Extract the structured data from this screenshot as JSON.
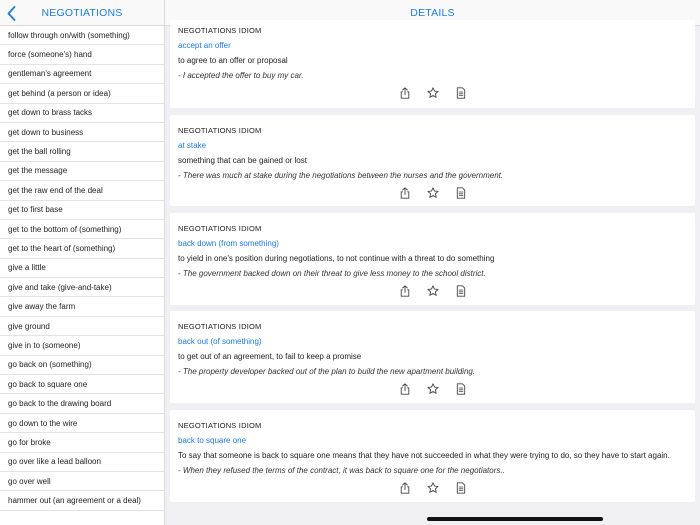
{
  "sidebar": {
    "title": "NEGOTIATIONS",
    "items": [
      "follow through on/with (something)",
      "force (someone's) hand",
      "gentleman's agreement",
      "get behind (a person or idea)",
      "get down to brass tacks",
      "get down to business",
      "get the ball rolling",
      "get the message",
      "get the raw end of the deal",
      "get to first base",
      "get to the bottom of (something)",
      "get to the heart of (something)",
      "give a little",
      "give and take (give-and-take)",
      "give away the farm",
      "give ground",
      "give in to (someone)",
      "go back on (something)",
      "go back to square one",
      "go back to the drawing board",
      "go down to the wire",
      "go for broke",
      "go over like a lead balloon",
      "go over well",
      "hammer out (an agreement or a deal)"
    ]
  },
  "main": {
    "title": "DETAILS",
    "cards": [
      {
        "category": "NEGOTIATIONS IDIOM",
        "term": "accept an offer",
        "definition": "to agree to an offer or proposal",
        "example": "- I accepted the offer to buy my car."
      },
      {
        "category": "NEGOTIATIONS IDIOM",
        "term": "at stake",
        "definition": "something that can be gained or lost",
        "example": "- There was much at stake during the negotiations between the nurses and the government."
      },
      {
        "category": "NEGOTIATIONS IDIOM",
        "term": "back down (from something)",
        "definition": "to yield in one's position during negotiations, to not continue with a threat to do something",
        "example": "- The government backed down on their threat to give less money to the school district."
      },
      {
        "category": "NEGOTIATIONS IDIOM",
        "term": "back out (of something)",
        "definition": "to get out of an agreement, to fail to keep a promise",
        "example": "- The property developer backed out of the plan to build the new apartment building."
      },
      {
        "category": "NEGOTIATIONS IDIOM",
        "term": "back to square one",
        "definition": "To say that someone is back to square one means that they have not succeeded in what they were trying to do, so they have to start again.",
        "example": "- When they refused the terms of the contract, it was back to square one for the negotiators.."
      }
    ]
  },
  "icons": {
    "back": "chevron-left-icon",
    "share": "share-icon",
    "favorite": "star-icon",
    "notes": "document-icon"
  },
  "colors": {
    "accent": "#1a7be0",
    "background": "#efeff4"
  }
}
